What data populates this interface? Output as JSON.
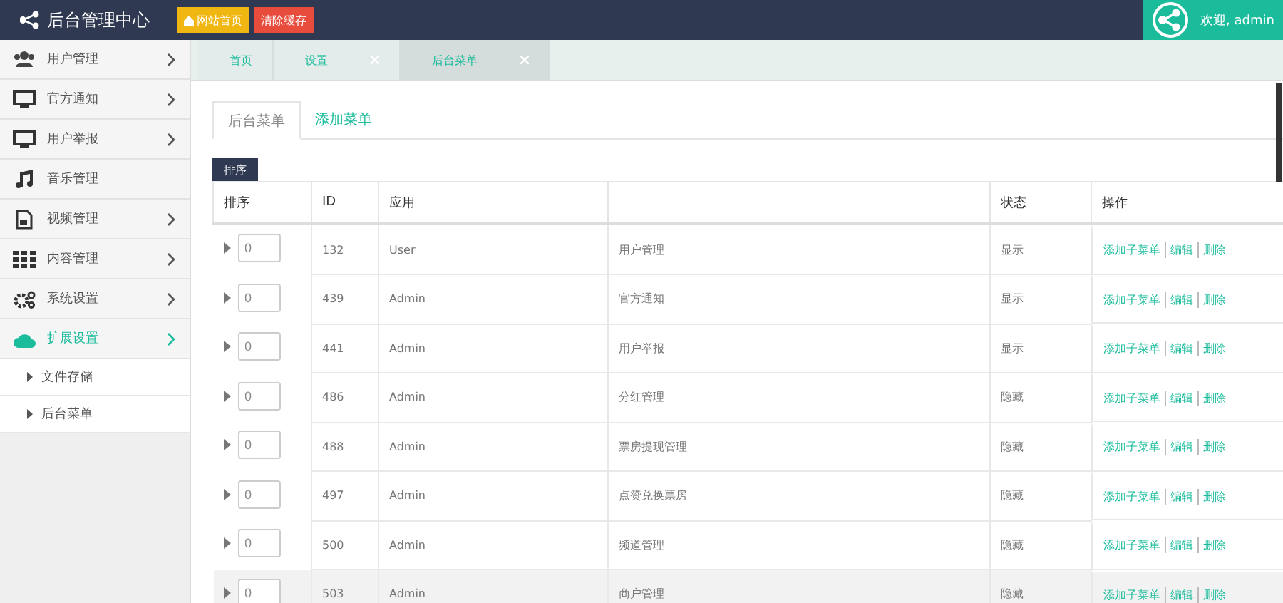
{
  "header": {
    "title": "后台管理中心",
    "buttons": [
      {
        "label": "网站首页",
        "kind": "home"
      },
      {
        "label": "清除缓存",
        "kind": "clear"
      }
    ],
    "welcome": "欢迎, admin"
  },
  "tabs": [
    {
      "label": "首页",
      "selected": false,
      "closable": false
    },
    {
      "label": "设置",
      "selected": false,
      "closable": true
    },
    {
      "label": "后台菜单",
      "selected": true,
      "closable": true
    }
  ],
  "sidebar": {
    "items": [
      {
        "label": "用户管理",
        "arrow": true,
        "expanded": false
      },
      {
        "label": "官方通知",
        "arrow": true,
        "expanded": false
      },
      {
        "label": "用户举报",
        "arrow": true,
        "expanded": false
      },
      {
        "label": "音乐管理",
        "arrow": false,
        "expanded": false
      },
      {
        "label": "视频管理",
        "arrow": true,
        "expanded": false
      },
      {
        "label": "内容管理",
        "arrow": true,
        "expanded": false
      },
      {
        "label": "系统设置",
        "arrow": true,
        "expanded": false
      },
      {
        "label": "扩展设置",
        "arrow": true,
        "expanded": true,
        "children": [
          {
            "label": "文件存储"
          },
          {
            "label": "后台菜单"
          }
        ]
      }
    ]
  },
  "content_tabs": [
    {
      "label": "后台菜单",
      "selected": true
    },
    {
      "label": "添加菜单",
      "selected": false
    }
  ],
  "sort_button": "排序",
  "table": {
    "headers": {
      "sort": "排序",
      "id": "ID",
      "app": "应用",
      "status": "状态",
      "actions": "操作"
    },
    "rows": [
      {
        "sort": "0",
        "id": "132",
        "app": "User",
        "name": "用户管理",
        "status": "显示",
        "actions": [
          "添加子菜单",
          "编辑",
          "删除"
        ],
        "hovered": false
      },
      {
        "sort": "0",
        "id": "439",
        "app": "Admin",
        "name": "官方通知",
        "status": "显示",
        "actions": [
          "添加子菜单",
          "编辑",
          "删除"
        ],
        "hovered": false
      },
      {
        "sort": "0",
        "id": "441",
        "app": "Admin",
        "name": "用户举报",
        "status": "显示",
        "actions": [
          "添加子菜单",
          "编辑",
          "删除"
        ],
        "hovered": false
      },
      {
        "sort": "0",
        "id": "486",
        "app": "Admin",
        "name": "分红管理",
        "status": "隐藏",
        "actions": [
          "添加子菜单",
          "编辑",
          "删除"
        ],
        "hovered": false
      },
      {
        "sort": "0",
        "id": "488",
        "app": "Admin",
        "name": "票房提现管理",
        "status": "隐藏",
        "actions": [
          "添加子菜单",
          "编辑",
          "删除"
        ],
        "hovered": false
      },
      {
        "sort": "0",
        "id": "497",
        "app": "Admin",
        "name": "点赞兑换票房",
        "status": "隐藏",
        "actions": [
          "添加子菜单",
          "编辑",
          "删除"
        ],
        "hovered": false
      },
      {
        "sort": "0",
        "id": "500",
        "app": "Admin",
        "name": "频道管理",
        "status": "隐藏",
        "actions": [
          "添加子菜单",
          "编辑",
          "删除"
        ],
        "hovered": false
      },
      {
        "sort": "0",
        "id": "503",
        "app": "Admin",
        "name": "商户管理",
        "status": "隐藏",
        "actions": [
          "添加子菜单",
          "编辑",
          "删除"
        ],
        "hovered": true
      }
    ]
  }
}
